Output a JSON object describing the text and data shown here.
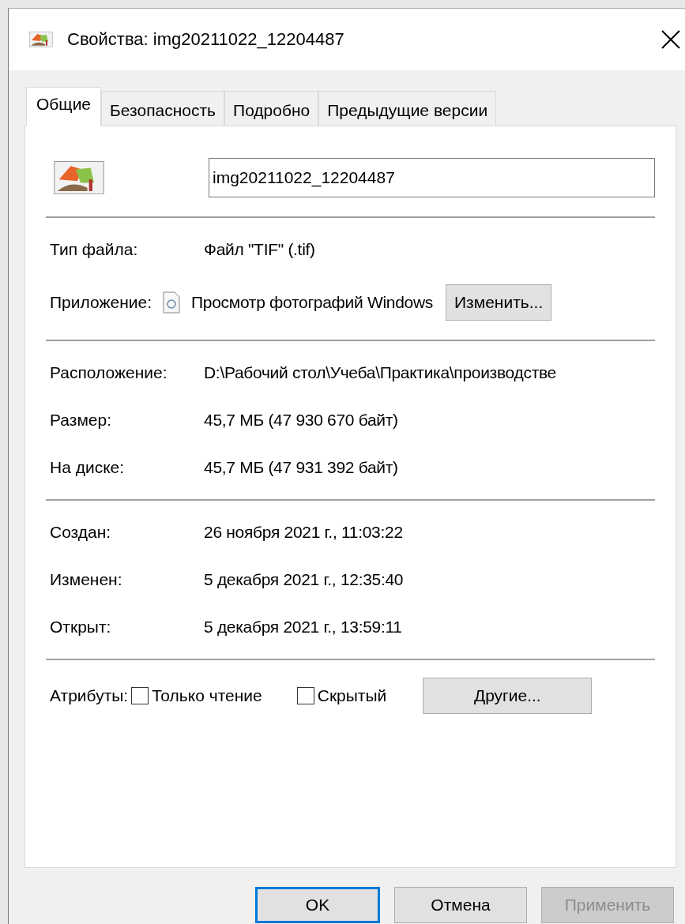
{
  "window": {
    "title": "Свойства: img20211022_12204487"
  },
  "tabs": [
    {
      "label": "Общие",
      "selected": true
    },
    {
      "label": "Безопасность",
      "selected": false
    },
    {
      "label": "Подробно",
      "selected": false
    },
    {
      "label": "Предыдущие версии",
      "selected": false
    }
  ],
  "file_name": {
    "value": "img20211022_12204487"
  },
  "sections": [
    [
      {
        "kind": "text",
        "label": "Тип файла:",
        "value": "Файл \"TIF\" (.tif)"
      },
      {
        "kind": "app",
        "label": "Приложение:",
        "value": "Просмотр фотографий Windows",
        "button": "Изменить..."
      }
    ],
    [
      {
        "kind": "text",
        "label": "Расположение:",
        "value": "D:\\Рабочий стол\\Учеба\\Практика\\производстве"
      },
      {
        "kind": "text",
        "label": "Размер:",
        "value": "45,7 МБ (47 930 670 байт)"
      },
      {
        "kind": "text",
        "label": "На диске:",
        "value": "45,7 МБ (47 931 392 байт)"
      }
    ],
    [
      {
        "kind": "text",
        "label": "Создан:",
        "value": "26 ноября 2021 г., 11:03:22"
      },
      {
        "kind": "text",
        "label": "Изменен:",
        "value": "5 декабря 2021 г., 12:35:40"
      },
      {
        "kind": "text",
        "label": "Открыт:",
        "value": "5 декабря 2021 г., 13:59:11"
      }
    ]
  ],
  "attributes": {
    "label": "Атрибуты:",
    "checkboxes": [
      {
        "label": "Только чтение",
        "checked": false
      },
      {
        "label": "Скрытый",
        "checked": false
      }
    ],
    "button": "Другие..."
  },
  "buttons": [
    {
      "label": "OK",
      "default": true,
      "disabled": false
    },
    {
      "label": "Отмена",
      "default": false,
      "disabled": false
    },
    {
      "label": "Применить",
      "default": false,
      "disabled": true
    }
  ]
}
